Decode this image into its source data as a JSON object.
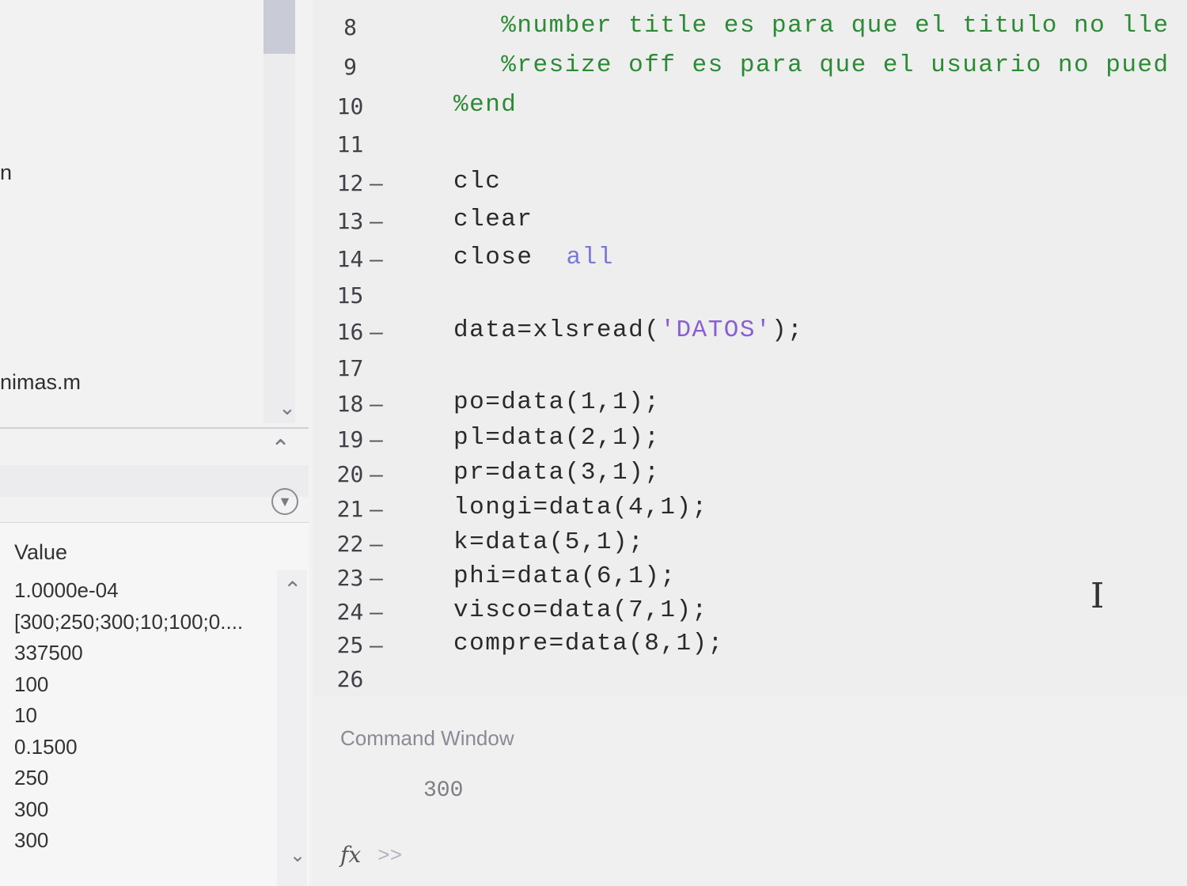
{
  "left_pane": {
    "files": [
      "n",
      "nimas.m"
    ],
    "workspace_header": "Value",
    "workspace_values": [
      "1.0000e-04",
      "[300;250;300;10;100;0....",
      "337500",
      "100",
      "10",
      "0.1500",
      "250",
      "300",
      "300"
    ]
  },
  "editor": {
    "lines": [
      {
        "num": "8",
        "bp": "",
        "code": "   %number title es para que el titulo no lle"
      },
      {
        "num": "9",
        "bp": "",
        "code": "   %resize off es para que el usuario no pued"
      },
      {
        "num": "10",
        "bp": "",
        "code": "%end"
      },
      {
        "num": "11",
        "bp": "",
        "code": ""
      },
      {
        "num": "12",
        "bp": "—",
        "code": "clc"
      },
      {
        "num": "13",
        "bp": "—",
        "code": "clear"
      },
      {
        "num": "14",
        "bp": "—",
        "code": "close"
      },
      {
        "num": "15",
        "bp": "",
        "code": ""
      },
      {
        "num": "16",
        "bp": "—",
        "code": "data=xlsread("
      },
      {
        "num": "17",
        "bp": "",
        "code": ""
      },
      {
        "num": "18",
        "bp": "—",
        "code": "po=data(1,1);"
      },
      {
        "num": "19",
        "bp": "—",
        "code": "pl=data(2,1);"
      },
      {
        "num": "20",
        "bp": "—",
        "code": "pr=data(3,1);"
      },
      {
        "num": "21",
        "bp": "—",
        "code": "longi=data(4,1);"
      },
      {
        "num": "22",
        "bp": "—",
        "code": "k=data(5,1);"
      },
      {
        "num": "23",
        "bp": "—",
        "code": "phi=data(6,1);"
      },
      {
        "num": "24",
        "bp": "—",
        "code": "visco=data(7,1);"
      },
      {
        "num": "25",
        "bp": "—",
        "code": "compre=data(8,1);"
      },
      {
        "num": "26",
        "bp": "",
        "code": ""
      }
    ],
    "close_arg": "all",
    "xlsread_arg": "'DATOS'",
    "xlsread_tail": ");"
  },
  "command_window": {
    "title": "Command Window",
    "output": "300",
    "fx": "fx",
    "prompt": ">>"
  }
}
